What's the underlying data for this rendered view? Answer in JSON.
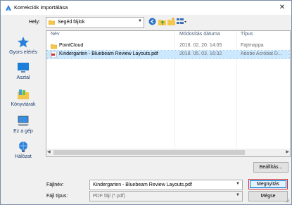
{
  "window": {
    "title": "Korrekciók importálása",
    "close_symbol": "✕"
  },
  "location": {
    "label": "Hely:",
    "value": "Segéd fájlok"
  },
  "places": [
    {
      "label": "Gyors elérés",
      "icon": "star-icon"
    },
    {
      "label": "Asztal",
      "icon": "desktop-icon"
    },
    {
      "label": "Könyvtárak",
      "icon": "libraries-icon"
    },
    {
      "label": "Ez a gép",
      "icon": "computer-icon"
    },
    {
      "label": "Hálózat",
      "icon": "network-icon"
    }
  ],
  "columns": {
    "name": "Név",
    "date": "Módosítás dátuma",
    "type": "Típus"
  },
  "files": [
    {
      "name": "PointCloud",
      "date": "2018. 02. 20. 14:05",
      "type": "Fájlmappa",
      "icon": "folder-icon",
      "selected": false
    },
    {
      "name": "Kindergarten - Bluebeam Review Layouts.pdf",
      "date": "2018. 05. 03. 16:32",
      "type": "Adobe Acrobat D...",
      "icon": "pdf-icon",
      "selected": true
    }
  ],
  "buttons": {
    "settings": "Beállítás...",
    "open": "Megnyitás",
    "cancel": "Mégse"
  },
  "filename": {
    "label": "Fájlnév:",
    "value": "Kindergarten - Bluebeam Review Layouts.pdf"
  },
  "filetype": {
    "label": "Fájl típus:",
    "value": "PDF fájl (*.pdf)"
  },
  "colors": {
    "selection": "#cce8ff",
    "accent": "#0078d7",
    "focus_border": "#d23232"
  }
}
